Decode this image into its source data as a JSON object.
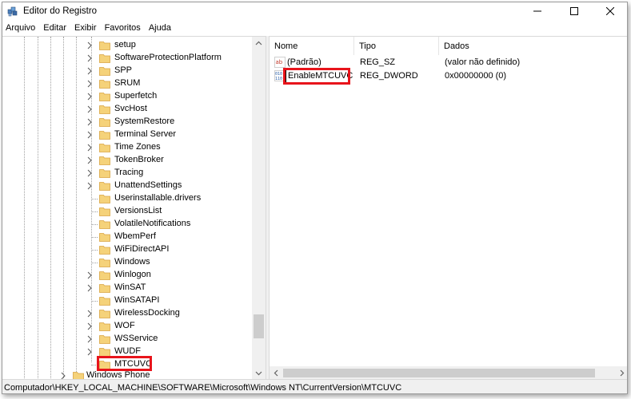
{
  "window": {
    "title": "Editor do Registro",
    "icon": "registry-editor-icon"
  },
  "menu": [
    "Arquivo",
    "Editar",
    "Exibir",
    "Favoritos",
    "Ajuda"
  ],
  "tree": {
    "items": [
      {
        "label": "setup",
        "expandable": true
      },
      {
        "label": "SoftwareProtectionPlatform",
        "expandable": true
      },
      {
        "label": "SPP",
        "expandable": true
      },
      {
        "label": "SRUM",
        "expandable": true
      },
      {
        "label": "Superfetch",
        "expandable": true
      },
      {
        "label": "SvcHost",
        "expandable": true
      },
      {
        "label": "SystemRestore",
        "expandable": true
      },
      {
        "label": "Terminal Server",
        "expandable": true
      },
      {
        "label": "Time Zones",
        "expandable": true
      },
      {
        "label": "TokenBroker",
        "expandable": true
      },
      {
        "label": "Tracing",
        "expandable": true
      },
      {
        "label": "UnattendSettings",
        "expandable": true
      },
      {
        "label": "Userinstallable.drivers",
        "expandable": false
      },
      {
        "label": "VersionsList",
        "expandable": false
      },
      {
        "label": "VolatileNotifications",
        "expandable": false
      },
      {
        "label": "WbemPerf",
        "expandable": false
      },
      {
        "label": "WiFiDirectAPI",
        "expandable": false
      },
      {
        "label": "Windows",
        "expandable": false
      },
      {
        "label": "Winlogon",
        "expandable": true
      },
      {
        "label": "WinSAT",
        "expandable": true
      },
      {
        "label": "WinSATAPI",
        "expandable": false
      },
      {
        "label": "WirelessDocking",
        "expandable": true
      },
      {
        "label": "WOF",
        "expandable": true
      },
      {
        "label": "WSService",
        "expandable": true
      },
      {
        "label": "WUDF",
        "expandable": true
      },
      {
        "label": "MTCUVC",
        "expandable": false,
        "selected": true
      }
    ],
    "parent_item": {
      "label": "Windows Phone",
      "expandable": true
    }
  },
  "list": {
    "columns": [
      "Nome",
      "Tipo",
      "Dados"
    ],
    "rows": [
      {
        "name": "(Padrão)",
        "type": "REG_SZ",
        "data": "(valor não definido)",
        "icon": "string-value-icon"
      },
      {
        "name": "EnableMTCUVC",
        "type": "REG_DWORD",
        "data": "0x00000000 (0)",
        "icon": "binary-value-icon",
        "editing": true
      }
    ]
  },
  "status": {
    "path": "Computador\\HKEY_LOCAL_MACHINE\\SOFTWARE\\Microsoft\\Windows NT\\CurrentVersion\\MTCUVC"
  },
  "colors": {
    "highlight": "#e8141b",
    "folder": "#f5d27a",
    "folder_edge": "#d9a441"
  }
}
